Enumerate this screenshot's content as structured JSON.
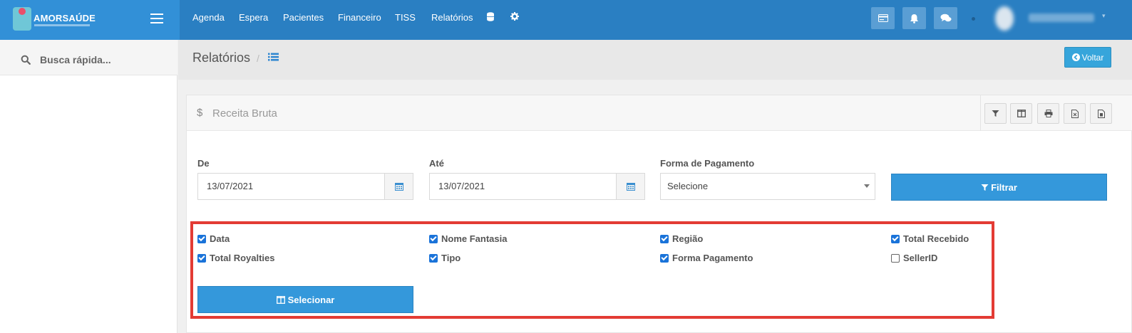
{
  "brand": {
    "name": "AMORSAÚDE"
  },
  "nav": {
    "links": [
      "Agenda",
      "Espera",
      "Pacientes",
      "Financeiro",
      "TISS",
      "Relatórios"
    ],
    "database_icon": "database-icon",
    "settings_icon": "gear-icon"
  },
  "sidebar": {
    "search_placeholder": "Busca rápida..."
  },
  "page": {
    "title": "Relatórios",
    "separator": "/",
    "back_label": "Voltar"
  },
  "panel": {
    "title": "Receita Bruta",
    "currency_symbol": "$",
    "tools": [
      "filter-icon",
      "columns-icon",
      "print-icon",
      "excel-icon",
      "pdf-icon"
    ]
  },
  "filters": {
    "from_label": "De",
    "from_value": "13/07/2021",
    "to_label": "Até",
    "to_value": "13/07/2021",
    "payment_label": "Forma de Pagamento",
    "payment_value": "Selecione",
    "filter_button": "Filtrar"
  },
  "columns": {
    "items": [
      {
        "label": "Data",
        "checked": true
      },
      {
        "label": "Nome Fantasia",
        "checked": true
      },
      {
        "label": "Região",
        "checked": true
      },
      {
        "label": "Total Recebido",
        "checked": true
      },
      {
        "label": "Total Royalties",
        "checked": true
      },
      {
        "label": "Tipo",
        "checked": true
      },
      {
        "label": "Forma Pagamento",
        "checked": true
      },
      {
        "label": "SellerID",
        "checked": false
      }
    ],
    "select_button": "Selecionar"
  },
  "colors": {
    "primary": "#3498db",
    "navbar": "#2a7fc2",
    "highlight": "#e33b34"
  }
}
